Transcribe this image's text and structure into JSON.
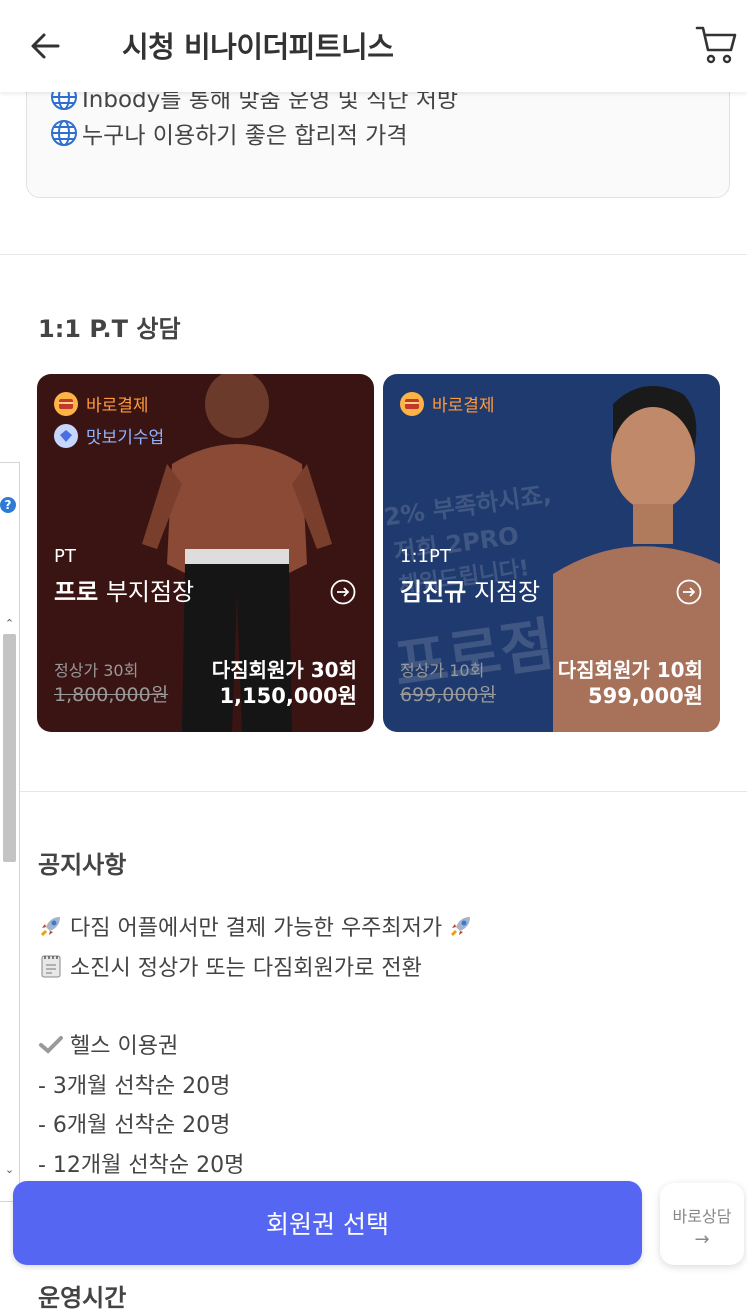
{
  "header": {
    "title": "시청 비나이더피트니스",
    "back_icon": "back-arrow-icon",
    "cart_icon": "cart-icon"
  },
  "info": {
    "line1": "Inbody를 통해 맞춤 운영 및 식단 처방",
    "line2": "누구나 이용하기 좋은 합리적 가격"
  },
  "pt_section": {
    "title": "1:1 P.T 상담",
    "cards": [
      {
        "badge_pay": "바로결제",
        "badge_trial": "맛보기수업",
        "type": "PT",
        "trainer_bold": "프로",
        "trainer_rest": "부지점장",
        "regular_label": "정상가 30회",
        "regular_price": "1,800,000원",
        "member_label": "다짐회원가 30회",
        "member_price": "1,150,000원"
      },
      {
        "badge_pay": "바로결제",
        "type": "1:1PT",
        "trainer_bold": "김진규",
        "trainer_rest": "지점장",
        "regular_label": "정상가 10회",
        "regular_price": "699,000원",
        "member_label": "다짐회원가 10회",
        "member_price": "599,000원",
        "watermark1": "2% 부족하시죠,",
        "watermark2": "저희 2PRO",
        "watermark3": "채워드립니다!",
        "watermark4": "프로점장"
      }
    ]
  },
  "notice_section": {
    "title": "공지사항",
    "lines": [
      "다짐 어플에서만 결제 가능한 우주최저가",
      "소진시 정상가 또는 다짐회원가로 전환",
      "헬스 이용권",
      "- 3개월 선착순 20명",
      "- 6개월 선착순 20명",
      "- 12개월 선착순 20명"
    ]
  },
  "cta": {
    "label": "회원권 선택"
  },
  "consult": {
    "line1": "바로상담",
    "line2": "→"
  },
  "next_section": {
    "title": "운영시간"
  },
  "colors": {
    "accent": "#5566f2",
    "pay_badge": "#ff9a3c",
    "trial_badge": "#8fb2ff"
  }
}
